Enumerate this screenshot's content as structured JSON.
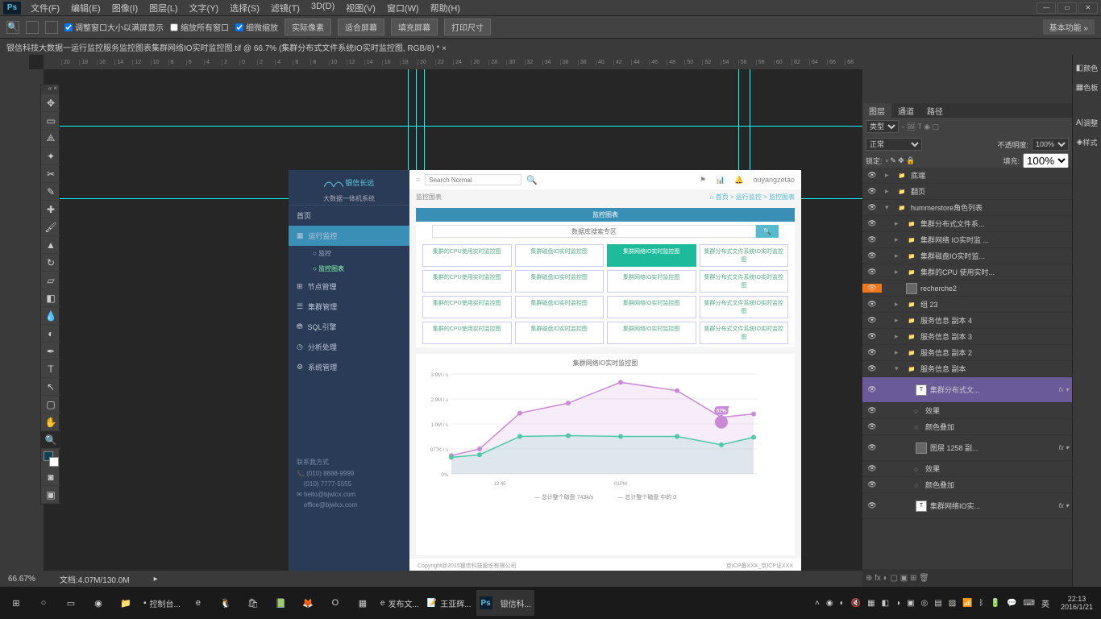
{
  "app": "Ps",
  "menu": [
    "文件(F)",
    "编辑(E)",
    "图像(I)",
    "图层(L)",
    "文字(Y)",
    "选择(S)",
    "滤镜(T)",
    "3D(D)",
    "视图(V)",
    "窗口(W)",
    "帮助(H)"
  ],
  "options": {
    "chk1": "调整窗口大小以满屏显示",
    "chk2": "缩放所有窗口",
    "chk3": "细微缩放",
    "btn1": "实际像素",
    "btn2": "适合屏幕",
    "btn3": "填充屏幕",
    "btn4": "打印尺寸",
    "right": "基本功能"
  },
  "tab": "银信科技大数据一运行监控服务监控图表集群网络IO实时监控图.tif @ 66.7% (集群分布式文件系统IO实时监控图, RGB/8) * ×",
  "status": {
    "zoom": "66.67%",
    "doc": "文档:4.07M/130.0M"
  },
  "ruler": [
    "",
    "20",
    "18",
    "16",
    "14",
    "12",
    "10",
    "8",
    "6",
    "4",
    "2",
    "0",
    "2",
    "4",
    "6",
    "8",
    "10",
    "12",
    "14",
    "16",
    "18",
    "20",
    "22",
    "24",
    "26",
    "28",
    "30",
    "32",
    "34",
    "36",
    "38",
    "40",
    "42",
    "44",
    "46",
    "48",
    "50",
    "52",
    "54",
    "56",
    "58",
    "60",
    "62",
    "64",
    "66",
    "68"
  ],
  "palette_tabs": [
    "颜色",
    "色板"
  ],
  "rtab": [
    "调整",
    "样式"
  ],
  "layers": {
    "tabs": [
      "图层",
      "通道",
      "路径"
    ],
    "kind": "类型",
    "blend": "正常",
    "opacity_l": "不透明度:",
    "opacity": "100%",
    "lock": "锁定:",
    "fill_l": "填充:",
    "fill": "100%",
    "items": [
      {
        "i": 0,
        "name": "底端",
        "type": "folder"
      },
      {
        "i": 0,
        "name": "翻页",
        "type": "folder"
      },
      {
        "i": 0,
        "name": "hummerstore角色列表",
        "type": "folder",
        "open": true
      },
      {
        "i": 1,
        "name": "集群分布式文件系...",
        "type": "folder"
      },
      {
        "i": 1,
        "name": "集群网络 IO实时监 ...",
        "type": "folder"
      },
      {
        "i": 1,
        "name": "集群磁盘IO实时监...",
        "type": "folder"
      },
      {
        "i": 1,
        "name": "集群的CPU 使用实时...",
        "type": "folder"
      },
      {
        "i": 1,
        "name": "recherche2",
        "type": "layer",
        "hl": true
      },
      {
        "i": 1,
        "name": "组 23",
        "type": "folder"
      },
      {
        "i": 1,
        "name": "服务信息 副本 4",
        "type": "folder"
      },
      {
        "i": 1,
        "name": "服务信息 副本 3",
        "type": "folder"
      },
      {
        "i": 1,
        "name": "服务信息 副本 2",
        "type": "folder"
      },
      {
        "i": 1,
        "name": "服务信息 副本",
        "type": "folder",
        "open": true
      },
      {
        "i": 2,
        "name": "集群分布式文...",
        "type": "text",
        "fx": true,
        "sel": true,
        "tall": true
      },
      {
        "i": 3,
        "name": "效果",
        "type": "fx"
      },
      {
        "i": 3,
        "name": "颜色叠加",
        "type": "fx"
      },
      {
        "i": 2,
        "name": "图层 1258 副...",
        "type": "layer",
        "fx": true,
        "tall": true
      },
      {
        "i": 3,
        "name": "效果",
        "type": "fx"
      },
      {
        "i": 3,
        "name": "颜色叠加",
        "type": "fx"
      },
      {
        "i": 2,
        "name": "集群网络IO实...",
        "type": "text",
        "fx": true,
        "tall": true
      }
    ]
  },
  "mock": {
    "logo": "银信长远",
    "logosub": "大数据一体机系统",
    "nav": [
      "首页",
      "运行监控",
      "节点管理",
      "集群管理",
      "SQL引擎",
      "分析处理",
      "系统管理"
    ],
    "nav_sub": [
      "监控",
      "监控图表"
    ],
    "contact": {
      "title": "联系我方式",
      "p1": "(010) 8888-9999",
      "p2": "(010) 7777-5555",
      "e1": "hello@bjwlcx.com",
      "e2": "office@bjwlcx.com"
    },
    "search_ph": "Search Normal",
    "user": "ouyangzetao",
    "crumb_l": "监控图表",
    "crumb_r": "首页 > 运行监控 > 监控图表",
    "panel_title": "监控图表",
    "panel_search": "数据库搜索专区",
    "buttons": [
      "集群的CPU使用实时监控图",
      "集群磁盘IO实时监控图",
      "集群网络IO实时监控图",
      "集群分布式文件系统IO实时监控图",
      "集群的CPU使用实时监控图",
      "集群磁盘IO实时监控图",
      "集群网络IO实时监控图",
      "集群分布式文件系统IO实时监控图",
      "集群的CPU使用实时监控图",
      "集群磁盘IO实时监控图",
      "集群网络IO实时监控图",
      "集群分布式文件系统IO实时监控图",
      "集群的CPU使用实时监控图",
      "集群磁盘IO实时监控图",
      "集群网络IO实时监控图",
      "集群分布式文件系统IO实时监控图"
    ],
    "chart_title": "集群网络IO实时监控图",
    "legend1": "总计整个磁盘          743k/s",
    "legend2": "总计整个磁盘 中的          0",
    "foot_l": "Copyright@2015银信科技股份有限公司",
    "foot_r": "京ICP备XXX_京ICP证XXX"
  },
  "chart_data": {
    "type": "line",
    "ylabels": [
      "0%",
      "977K / s",
      "1.0M / s",
      "2.9M / s",
      "3.9M / s"
    ],
    "xlabels": [
      "12:45",
      "01PM"
    ],
    "badge": "62%",
    "series": [
      {
        "name": "purple",
        "color": "#c989d4",
        "points": [
          [
            0,
            22
          ],
          [
            35,
            30
          ],
          [
            85,
            73
          ],
          [
            145,
            85
          ],
          [
            210,
            110
          ],
          [
            280,
            100
          ],
          [
            335,
            68
          ],
          [
            375,
            72
          ]
        ]
      },
      {
        "name": "green",
        "color": "#4ec9a5",
        "points": [
          [
            0,
            20
          ],
          [
            35,
            23
          ],
          [
            85,
            45
          ],
          [
            145,
            46
          ],
          [
            210,
            45
          ],
          [
            280,
            45
          ],
          [
            335,
            35
          ],
          [
            375,
            44
          ]
        ]
      }
    ]
  },
  "taskbar": {
    "apps": [
      "控制台...",
      "发布文...",
      "王亚辉...",
      "银信科..."
    ],
    "time": "22:13",
    "date": "2016/1/21",
    "ime": "英"
  }
}
